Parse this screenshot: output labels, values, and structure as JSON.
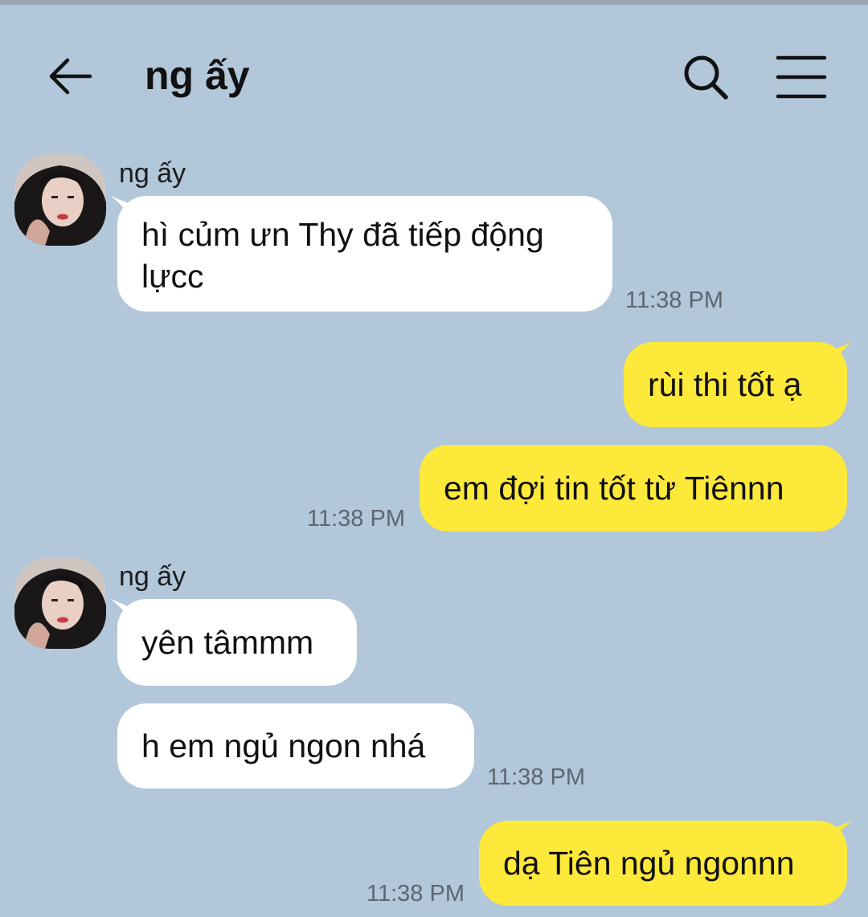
{
  "header": {
    "title": "ng ấy",
    "back_icon": "arrow-left-icon",
    "search_icon": "search-icon",
    "menu_icon": "hamburger-menu-icon"
  },
  "colors": {
    "background": "#b2c7da",
    "incoming_bubble": "#ffffff",
    "outgoing_bubble": "#fde93a",
    "timestamp": "#5e6670"
  },
  "messages": [
    {
      "direction": "incoming",
      "sender": "ng ấy",
      "texts": [
        "hì củm ưn Thy đã tiếp động lựcc"
      ],
      "time": "11:38 PM"
    },
    {
      "direction": "outgoing",
      "texts": [
        "rùi thi tốt ạ",
        "em đợi tin tốt từ Tiênnn"
      ],
      "time": "11:38 PM"
    },
    {
      "direction": "incoming",
      "sender": "ng ấy",
      "texts": [
        "yên tâmmm",
        "h em ngủ ngon nhá"
      ],
      "time": "11:38 PM"
    },
    {
      "direction": "outgoing",
      "texts": [
        "dạ Tiên ngủ ngonnn"
      ],
      "time": "11:38 PM"
    }
  ]
}
